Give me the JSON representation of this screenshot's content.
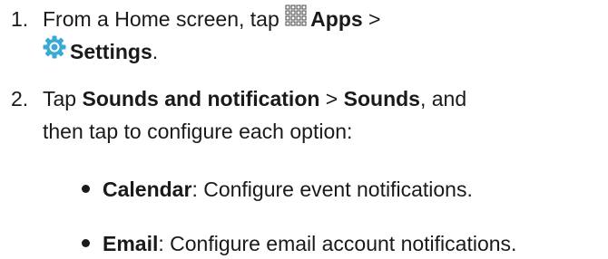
{
  "steps": [
    {
      "number": "1.",
      "line1": {
        "pre": "From a Home screen, tap ",
        "icon": "apps-grid-icon",
        "bold": "Apps",
        "post": " >"
      },
      "line2": {
        "icon": "settings-gear-icon",
        "bold": "Settings",
        "post": "."
      }
    },
    {
      "number": "2.",
      "line1": {
        "pre": "Tap ",
        "bold1": "Sounds and notification",
        "mid": " > ",
        "bold2": "Sounds",
        "post": ", and"
      },
      "line2": "then tap to configure each option:"
    }
  ],
  "bullets": [
    {
      "bold": "Calendar",
      "text": ": Configure event notifications."
    },
    {
      "bold": "Email",
      "text": ": Configure email account notifications."
    }
  ],
  "colors": {
    "text": "#1a1a1a",
    "settings_icon": "#3aa9d6"
  }
}
